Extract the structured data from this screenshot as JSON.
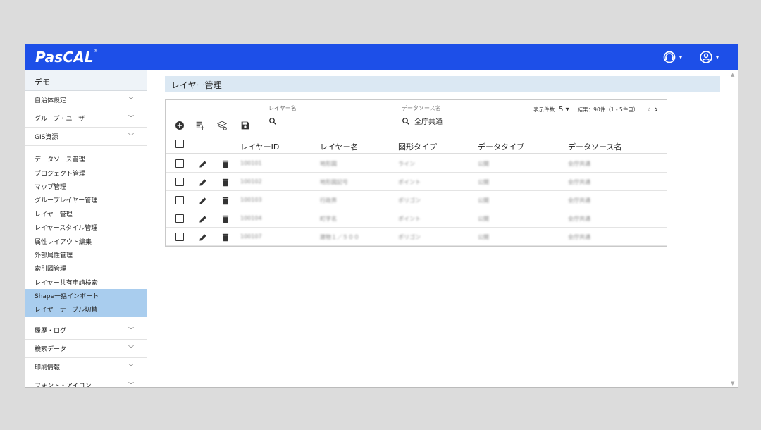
{
  "brand": {
    "logo": "PasCAL",
    "reg": "®"
  },
  "topbar": {
    "support_icon": "headset-icon",
    "user_icon": "account-circle-icon",
    "caret": "▾"
  },
  "sidebar": {
    "header": "デモ",
    "groups_top": [
      {
        "label": "自治体設定"
      },
      {
        "label": "グループ・ユーザー"
      },
      {
        "label": "GIS資源"
      }
    ],
    "sub_items": [
      {
        "label": "データソース管理"
      },
      {
        "label": "プロジェクト管理"
      },
      {
        "label": "マップ管理"
      },
      {
        "label": "グループレイヤー管理"
      },
      {
        "label": "レイヤー管理"
      },
      {
        "label": "レイヤースタイル管理"
      },
      {
        "label": "属性レイアウト編集"
      },
      {
        "label": "外部属性管理"
      },
      {
        "label": "索引図管理"
      },
      {
        "label": "レイヤー共有申請検索"
      },
      {
        "label": "Shape一括インポート",
        "selected": true
      },
      {
        "label": "レイヤーテーブル切替",
        "selected": true
      }
    ],
    "groups_bottom": [
      {
        "label": "履歴・ログ"
      },
      {
        "label": "検索データ"
      },
      {
        "label": "印刷情報"
      },
      {
        "label": "フォント・アイコン"
      }
    ]
  },
  "main": {
    "title": "レイヤー管理",
    "filters": {
      "layer_name_label": "レイヤー名",
      "layer_name_value": "",
      "datasource_label": "データソース名",
      "datasource_value": "全庁共通"
    },
    "pager": {
      "per_page_label": "表示件数",
      "per_page_value": "5",
      "result_text": "結果：90件（1 - 5件目）",
      "prev": "‹",
      "next": "›"
    },
    "columns": [
      "レイヤーID",
      "レイヤー名",
      "図形タイプ",
      "データタイプ",
      "データソース名"
    ],
    "rows": [
      [
        "100101",
        "地形図",
        "ライン",
        "公開",
        "全庁共通"
      ],
      [
        "100102",
        "地形図記号",
        "ポイント",
        "公開",
        "全庁共通"
      ],
      [
        "100103",
        "行政界",
        "ポリゴン",
        "公開",
        "全庁共通"
      ],
      [
        "100104",
        "町字名",
        "ポイント",
        "公開",
        "全庁共通"
      ],
      [
        "100107",
        "建物１／５００",
        "ポリゴン",
        "公開",
        "全庁共通"
      ]
    ]
  },
  "colors": {
    "brand_blue": "#1d4fe8",
    "selected": "#a9cdee",
    "title_bg": "#dbe8f3"
  }
}
